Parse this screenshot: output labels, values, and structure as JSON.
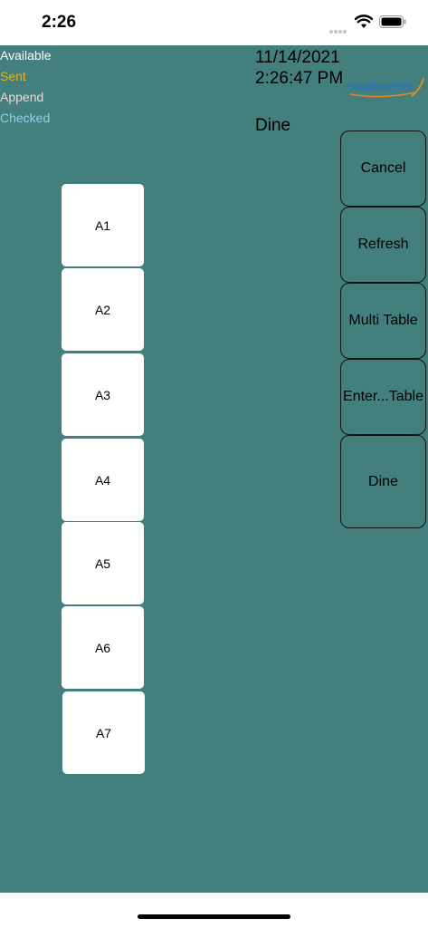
{
  "status_bar": {
    "time": "2:26"
  },
  "legend": {
    "available": "Available",
    "sent": "Sent",
    "append": "Append",
    "checked": "Checked"
  },
  "header": {
    "datetime": "11/14/2021 2:26:47 PM",
    "mode": "Dine",
    "logo_text": "FoodZone POS"
  },
  "tables": [
    {
      "label": "A1"
    },
    {
      "label": "A2"
    },
    {
      "label": "A3"
    },
    {
      "label": "A4"
    },
    {
      "label": "A5"
    },
    {
      "label": "A6"
    },
    {
      "label": "A7"
    }
  ],
  "actions": {
    "cancel": "Cancel",
    "refresh": "Refresh",
    "multi_table": "Multi Table",
    "enter_table": "Enter...Table",
    "dine": "Dine"
  },
  "colors": {
    "background": "#437f7c",
    "sent": "#e6b422",
    "append": "#f3d6d6",
    "checked": "#8fd3e8"
  }
}
